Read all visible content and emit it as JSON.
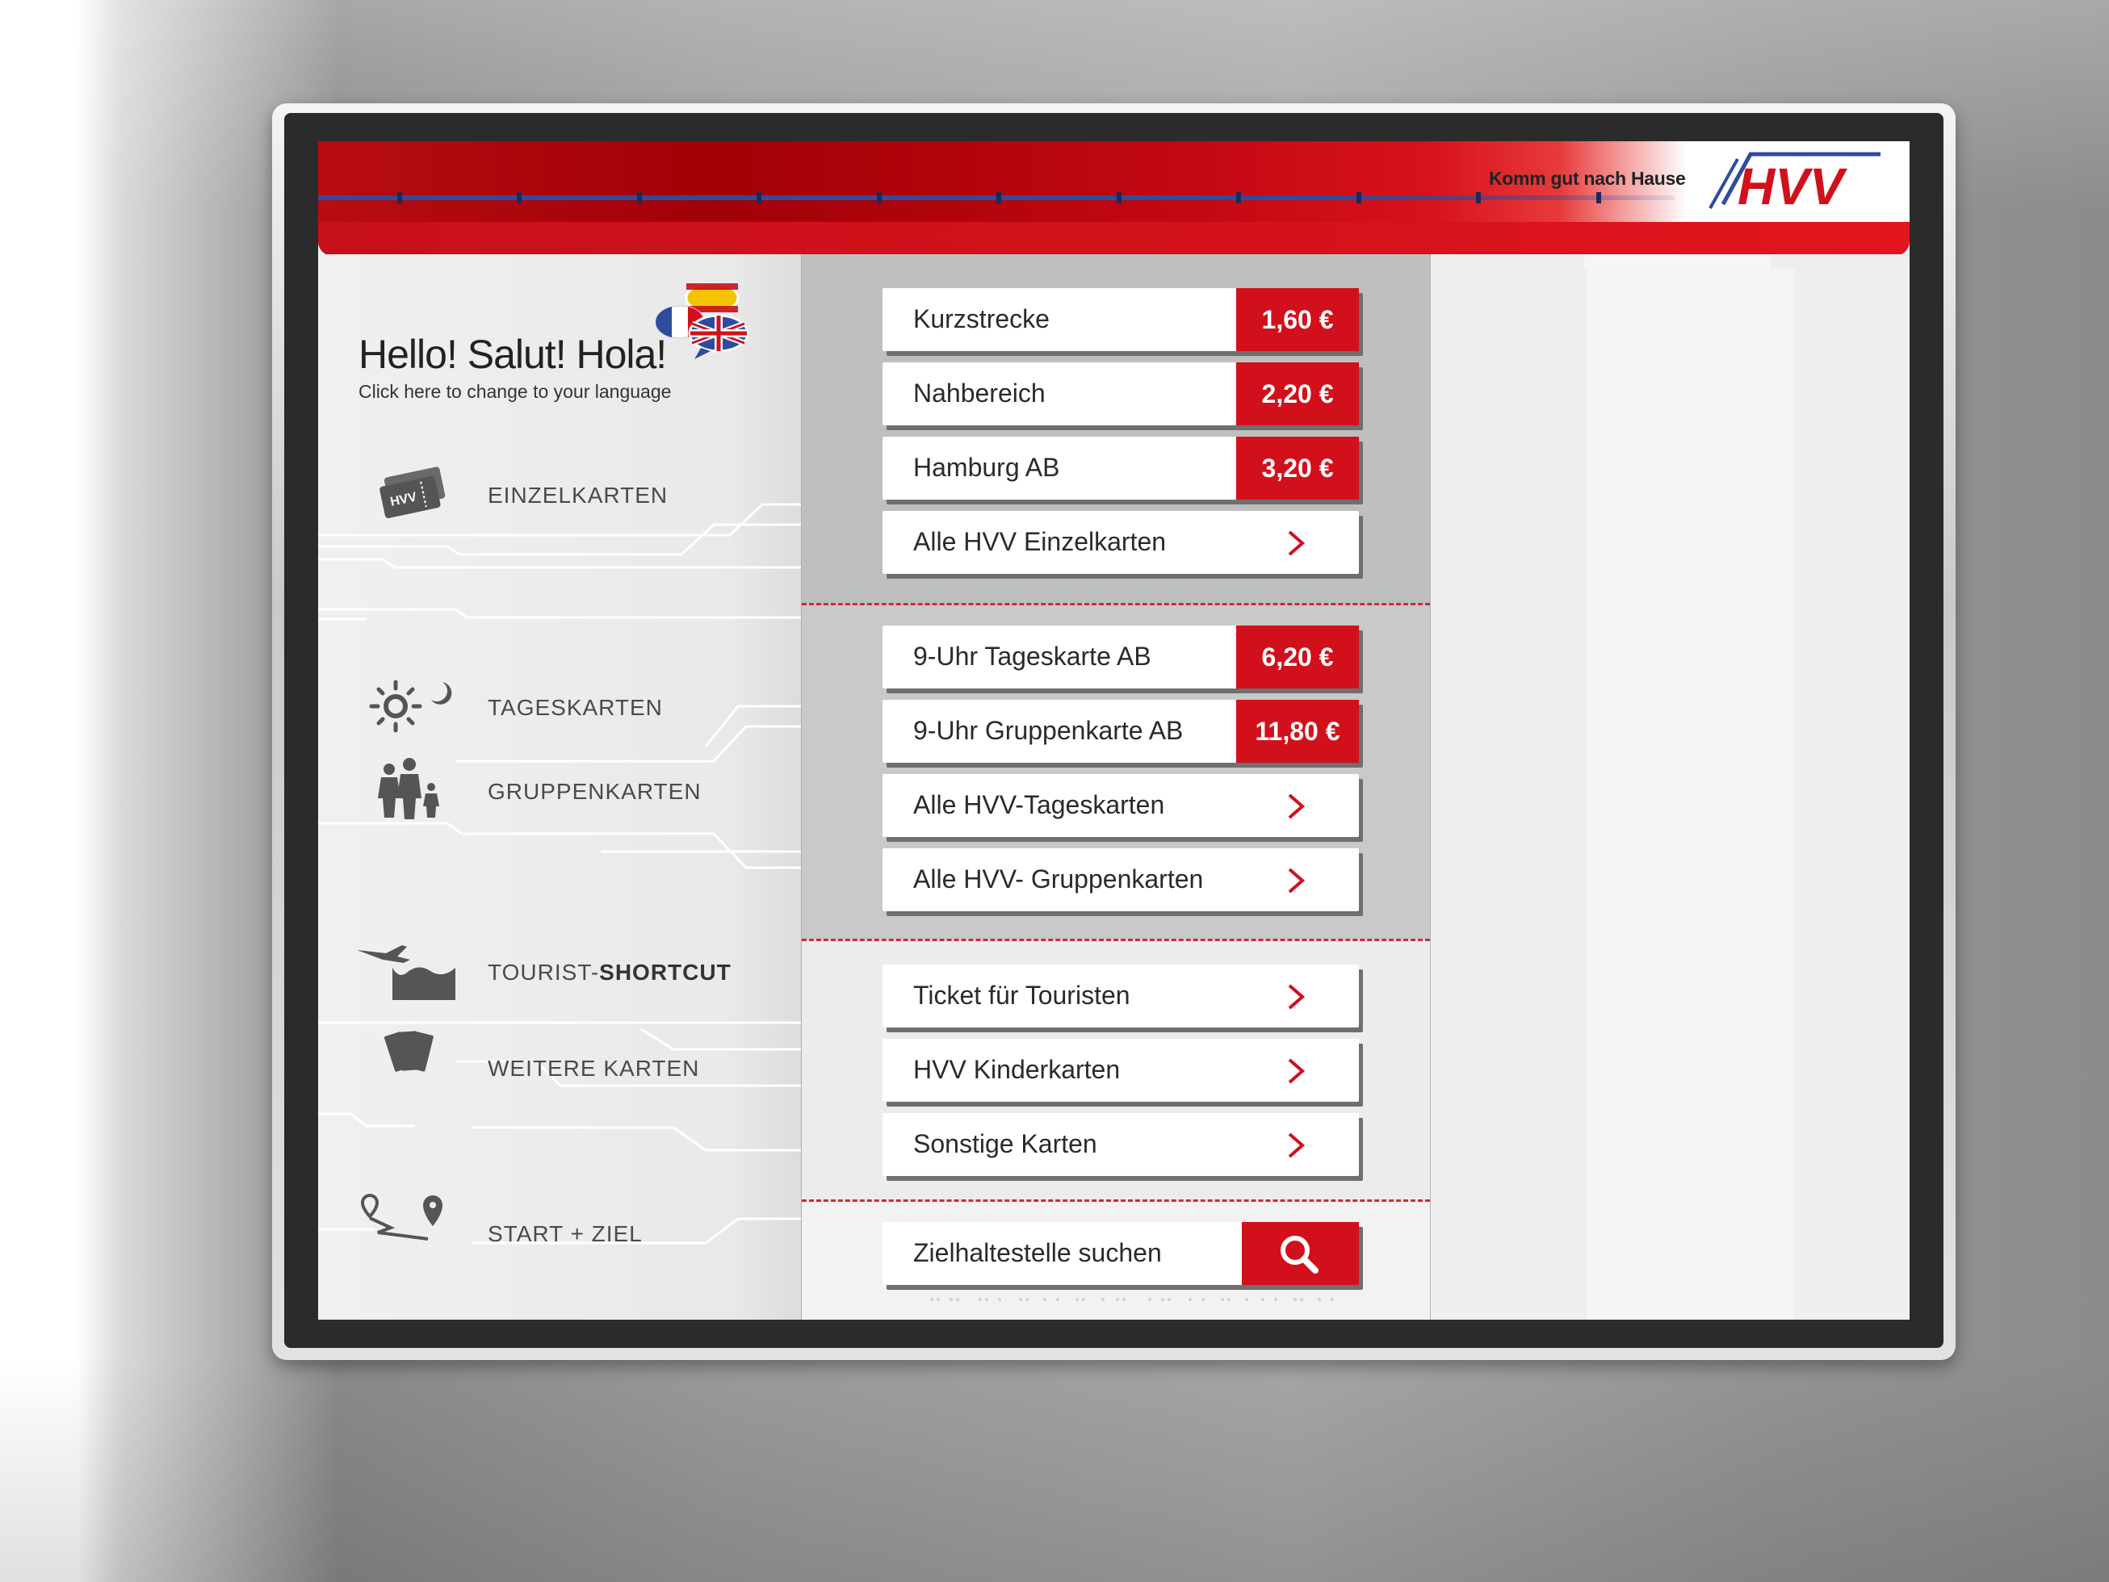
{
  "header": {
    "slogan": "Komm gut nach Hause",
    "logo_text": "HVV",
    "brand_red": "#d2101b",
    "brand_blue": "#2d4c9e"
  },
  "language": {
    "title": "Hello! Salut! Hola!",
    "subtitle": "Click here to change to your language",
    "flags": [
      "flag-france-icon",
      "flag-spain-icon",
      "flag-uk-icon"
    ]
  },
  "nav": {
    "einzelkarten": "EINZELKARTEN",
    "tageskarten": "TAGESKARTEN",
    "gruppenkarten": "GRUPPENKARTEN",
    "tourist_prefix": "TOURIST-",
    "tourist_bold": "SHORTCUT",
    "weitere": "WEITERE KARTEN",
    "start_ziel": "START + ZIEL"
  },
  "tickets": {
    "einzel": [
      {
        "label": "Kurzstrecke",
        "price": "1,60 €"
      },
      {
        "label": "Nahbereich",
        "price": "2,20 €"
      },
      {
        "label": "Hamburg AB",
        "price": "3,20 €"
      }
    ],
    "alle_einzel": "Alle HVV Einzelkarten",
    "tages": [
      {
        "label": "9-Uhr Tageskarte AB",
        "price": "6,20 €"
      },
      {
        "label": "9-Uhr Gruppenkarte AB",
        "price": "11,80 €"
      }
    ],
    "alle_tages": "Alle HVV-Tageskarten",
    "alle_gruppen": "Alle HVV- Gruppenkarten",
    "touristen": "Ticket für Touristen",
    "kinder": "HVV Kinderkarten",
    "sonstige": "Sonstige Karten"
  },
  "search": {
    "label": "Zielhaltestelle suchen"
  }
}
